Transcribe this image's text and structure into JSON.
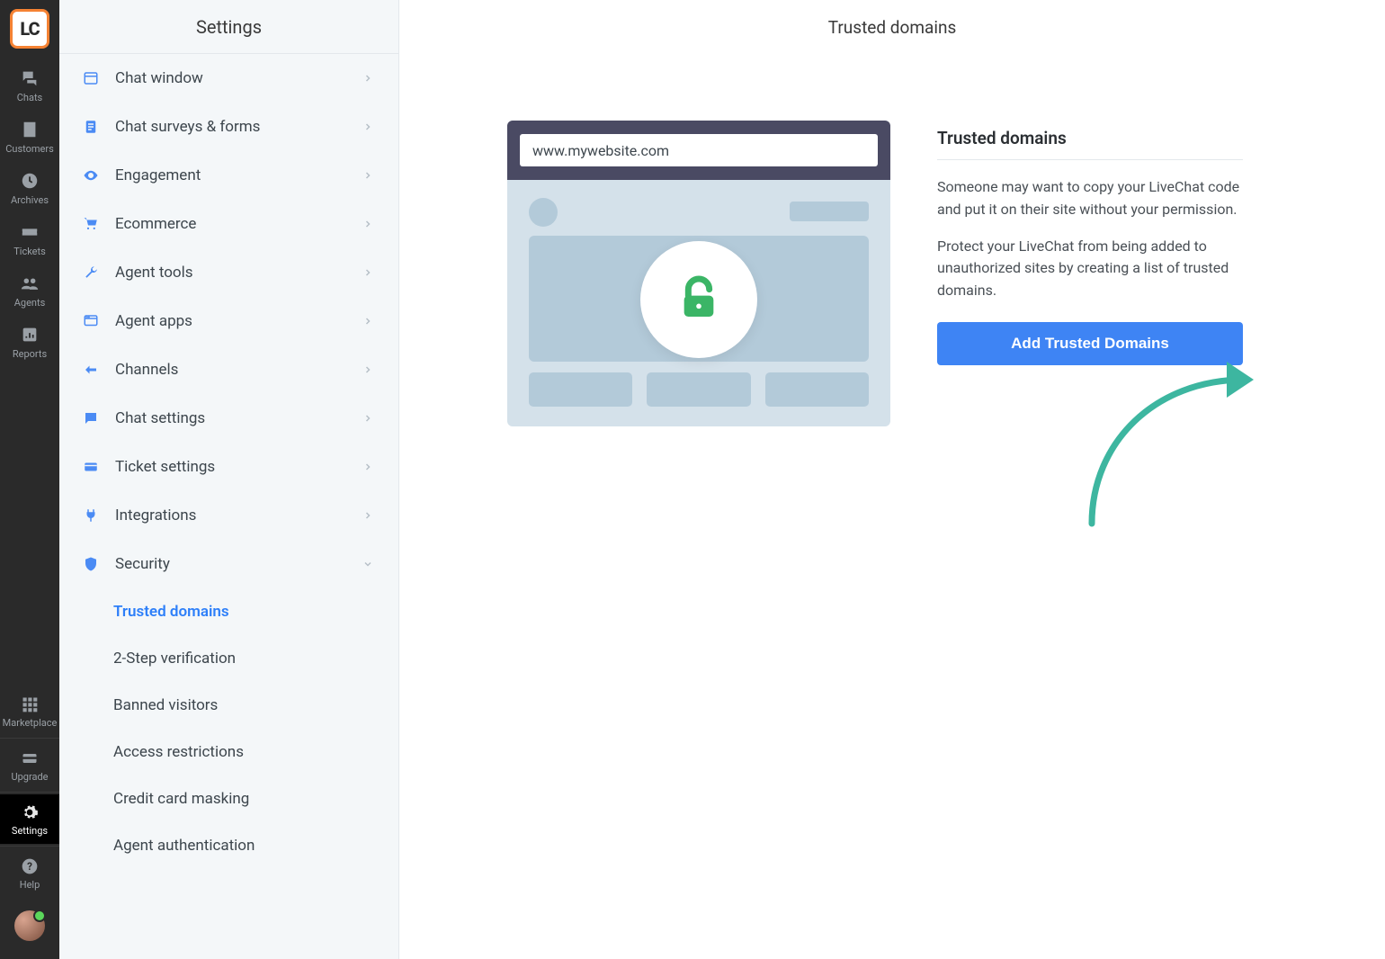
{
  "rail": {
    "items": [
      {
        "label": "Chats"
      },
      {
        "label": "Customers"
      },
      {
        "label": "Archives"
      },
      {
        "label": "Tickets"
      },
      {
        "label": "Agents"
      },
      {
        "label": "Reports"
      }
    ],
    "bottom": [
      {
        "label": "Marketplace"
      },
      {
        "label": "Upgrade"
      },
      {
        "label": "Settings"
      },
      {
        "label": "Help"
      }
    ]
  },
  "settings": {
    "title": "Settings",
    "sections": [
      {
        "label": "Chat window"
      },
      {
        "label": "Chat surveys & forms"
      },
      {
        "label": "Engagement"
      },
      {
        "label": "Ecommerce"
      },
      {
        "label": "Agent tools"
      },
      {
        "label": "Agent apps"
      },
      {
        "label": "Channels"
      },
      {
        "label": "Chat settings"
      },
      {
        "label": "Ticket settings"
      },
      {
        "label": "Integrations"
      },
      {
        "label": "Security"
      }
    ],
    "security_sub": [
      {
        "label": "Trusted domains"
      },
      {
        "label": "2-Step verification"
      },
      {
        "label": "Banned visitors"
      },
      {
        "label": "Access restrictions"
      },
      {
        "label": "Credit card masking"
      },
      {
        "label": "Agent authentication"
      }
    ]
  },
  "main": {
    "title": "Trusted domains",
    "illustration_url": "www.mywebsite.com",
    "heading": "Trusted domains",
    "para1": "Someone may want to copy your LiveChat code and put it on their site without your permission.",
    "para2": "Protect your LiveChat from being added to unauthorized sites by creating a list of trusted domains.",
    "button": "Add Trusted Domains"
  },
  "logo_text": "LC"
}
